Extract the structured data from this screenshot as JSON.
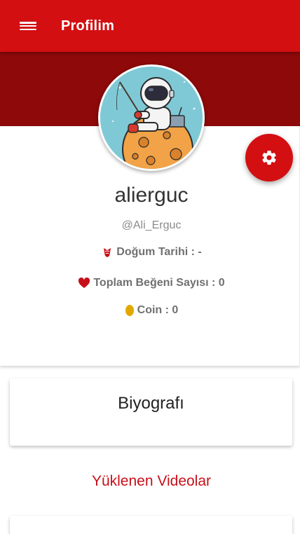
{
  "header": {
    "title": "Profilim",
    "menu_icon": "menu-icon",
    "color": "#d30f12"
  },
  "banner": {
    "color": "#8e090a"
  },
  "profile": {
    "avatar": "astronaut-on-moon-avatar",
    "settings_icon": "gear-icon",
    "name": "alierguc",
    "handle": "@Ali_Erguc",
    "birth_date": "Doğum Tarihi : -",
    "total_likes": "Toplam Beğeni Sayısı : 0",
    "coins": "Coin : 0"
  },
  "bio": {
    "title": "Biyografı"
  },
  "videos": {
    "title": "Yüklenen Videolar"
  },
  "colors": {
    "accent": "#d30f12",
    "dark_red": "#8e090a",
    "link_red": "#c8101a",
    "coin": "#e0a800"
  }
}
